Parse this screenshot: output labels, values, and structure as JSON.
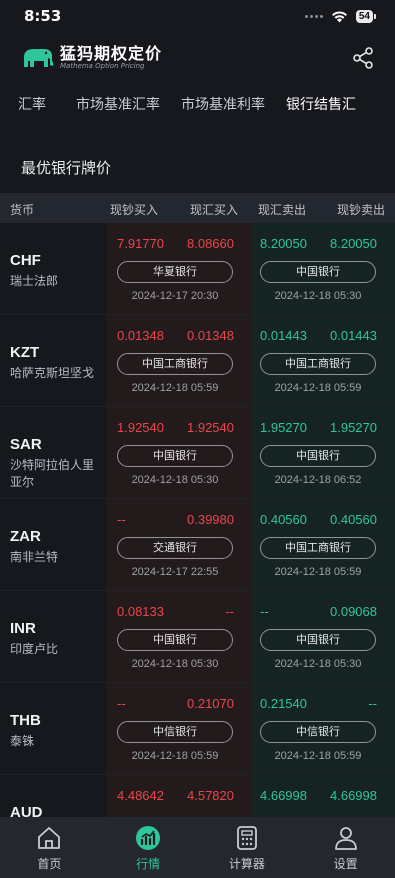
{
  "status_bar": {
    "time": "8:53",
    "battery": "54"
  },
  "header": {
    "logo_text": "猛犸期权定价",
    "logo_sub": "Mathema Option Pricing",
    "share_icon": "share-icon"
  },
  "tabs": [
    "汇率",
    "市场基准汇率",
    "市场基准利率",
    "银行结售汇"
  ],
  "section_title": "最优银行牌价",
  "table_header": [
    "货币",
    "现钞买入",
    "现汇买入",
    "现汇卖出",
    "现钞卖出"
  ],
  "rows": [
    {
      "code": "CHF",
      "name": "瑞士法郎",
      "cash_buy": "7.91770",
      "spot_buy": "8.08660",
      "buy_bank": "华夏银行",
      "buy_time": "2024-12-17 20:30",
      "spot_sell": "8.20050",
      "cash_sell": "8.20050",
      "sell_bank": "中国银行",
      "sell_time": "2024-12-18 05:30"
    },
    {
      "code": "KZT",
      "name": "哈萨克斯坦坚戈",
      "cash_buy": "0.01348",
      "spot_buy": "0.01348",
      "buy_bank": "中国工商银行",
      "buy_time": "2024-12-18 05:59",
      "spot_sell": "0.01443",
      "cash_sell": "0.01443",
      "sell_bank": "中国工商银行",
      "sell_time": "2024-12-18 05:59"
    },
    {
      "code": "SAR",
      "name": "沙特阿拉伯人里亚尔",
      "cash_buy": "1.92540",
      "spot_buy": "1.92540",
      "buy_bank": "中国银行",
      "buy_time": "2024-12-18 05:30",
      "spot_sell": "1.95270",
      "cash_sell": "1.95270",
      "sell_bank": "中国银行",
      "sell_time": "2024-12-18 06:52"
    },
    {
      "code": "ZAR",
      "name": "南非兰特",
      "cash_buy": "--",
      "spot_buy": "0.39980",
      "buy_bank": "交通银行",
      "buy_time": "2024-12-17 22:55",
      "spot_sell": "0.40560",
      "cash_sell": "0.40560",
      "sell_bank": "中国工商银行",
      "sell_time": "2024-12-18 05:59"
    },
    {
      "code": "INR",
      "name": "印度卢比",
      "cash_buy": "0.08133",
      "spot_buy": "--",
      "buy_bank": "中国银行",
      "buy_time": "2024-12-18 05:30",
      "spot_sell": "--",
      "cash_sell": "0.09068",
      "sell_bank": "中国银行",
      "sell_time": "2024-12-18 05:30"
    },
    {
      "code": "THB",
      "name": "泰铢",
      "cash_buy": "--",
      "spot_buy": "0.21070",
      "buy_bank": "中信银行",
      "buy_time": "2024-12-18 05:59",
      "spot_sell": "0.21540",
      "cash_sell": "--",
      "sell_bank": "中信银行",
      "sell_time": "2024-12-18 05:59"
    },
    {
      "code": "AUD",
      "name": "",
      "cash_buy": "4.48642",
      "spot_buy": "4.57820",
      "buy_bank": "",
      "buy_time": "",
      "spot_sell": "4.66998",
      "cash_sell": "4.66998",
      "sell_bank": "",
      "sell_time": ""
    }
  ],
  "bottom_nav": [
    {
      "label": "首页",
      "icon": "home-icon"
    },
    {
      "label": "行情",
      "icon": "market-chart-icon"
    },
    {
      "label": "计算器",
      "icon": "calculator-icon"
    },
    {
      "label": "设置",
      "icon": "user-icon"
    }
  ],
  "colors": {
    "accent": "#2fc69a",
    "down": "#e8474c",
    "background": "#16181e"
  }
}
